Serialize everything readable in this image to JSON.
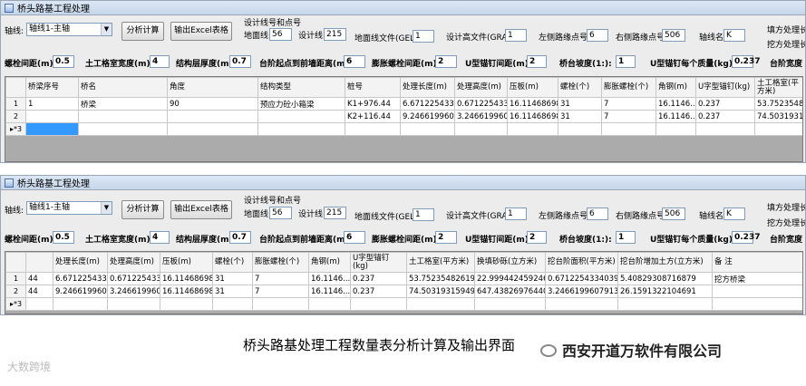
{
  "windows": [
    {
      "title": "桥头路基工程处理",
      "axis_label": "轴线:",
      "axis_value": "轴线1-主轴",
      "analyze_button": "分析计算",
      "export_button": "输出Excel表格",
      "design_line_label": "设计线号和点号",
      "ground_line_label": "地面线:",
      "ground_line_value": "56",
      "design_line_label2": "设计线:",
      "design_line_value": "215",
      "gel_label": "地面线文件(GEL):",
      "gel_value": "1",
      "gra_label": "设计高文件(GRA):",
      "gra_value": "1",
      "left_pt_label": "左侧路缘点号:",
      "left_pt_value": "6",
      "right_pt_label": "右侧路缘点号:",
      "right_pt_value": "506",
      "axis_name_label": "轴线名:",
      "axis_name_value": "K",
      "right_note1": "填方处理长度",
      "right_note2": "挖方处理长度",
      "params": [
        {
          "label": "螺栓间距(m):",
          "value": "0.5"
        },
        {
          "label": "土工格室宽度(m):",
          "value": "4"
        },
        {
          "label": "结构层厚度(m):",
          "value": "0.7"
        },
        {
          "label": "台阶起点到前墙距离(m):",
          "value": "6"
        },
        {
          "label": "膨胀螺栓间距(m):",
          "value": "2"
        },
        {
          "label": "U型锚钉间距(m):",
          "value": "2"
        },
        {
          "label": "桥台坡度(1:):",
          "value": "1"
        },
        {
          "label": "U型锚钉每个质量(kg):",
          "value": "0.237"
        },
        {
          "label": "台阶宽度",
          "value": ""
        }
      ],
      "table": {
        "headers": [
          "桥梁序号",
          "桥名",
          "角度",
          "结构类型",
          "桩号",
          "处理长度(m)",
          "处理高度(m)",
          "压板(m)",
          "螺栓(个)",
          "膨胀螺栓(个)",
          "角钢(m)",
          "U字型锚钉(kg)",
          "土工格室(平方米)"
        ],
        "rows": [
          {
            "n": "1",
            "cells": [
              "1",
              "桥梁",
              "90",
              "预应力砼小箱梁",
              "K1+976.44",
              "6.671225433...",
              "0.671225433...",
              "16.11468698...",
              "31",
              "7",
              "16.1146...",
              "0.237",
              "53.752354826192"
            ]
          },
          {
            "n": "2",
            "cells": [
              "",
              "",
              "",
              "",
              "K2+116.44",
              "9.246619960...",
              "3.246619960...",
              "16.11468698...",
              "31",
              "7",
              "16.1146...",
              "0.237",
              "74.5031931594923"
            ]
          },
          {
            "n": "▸*3",
            "cells": [
              "",
              "",
              "",
              "",
              "",
              "",
              "",
              "",
              "",
              "",
              "",
              "",
              ""
            ]
          }
        ]
      }
    },
    {
      "title": "桥头路基工程处理",
      "axis_label": "轴线:",
      "axis_value": "轴线1-主轴",
      "analyze_button": "分析计算",
      "export_button": "输出Excel表格",
      "design_line_label": "设计线号和点号",
      "ground_line_label": "地面线:",
      "ground_line_value": "56",
      "design_line_label2": "设计线:",
      "design_line_value": "215",
      "gel_label": "地面线文件(GEL):",
      "gel_value": "1",
      "gra_label": "设计高文件(GRA):",
      "gra_value": "1",
      "left_pt_label": "左侧路缘点号:",
      "left_pt_value": "6",
      "right_pt_label": "右侧路缘点号:",
      "right_pt_value": "506",
      "axis_name_label": "轴线名:",
      "axis_name_value": "K",
      "right_note1": "填方处理长度",
      "right_note2": "挖方处理长度",
      "params": [
        {
          "label": "螺栓间距(m):",
          "value": "0.5"
        },
        {
          "label": "土工格室宽度(m):",
          "value": "4"
        },
        {
          "label": "结构层厚度(m):",
          "value": "0.7"
        },
        {
          "label": "台阶起点到前墙距离(m):",
          "value": "6"
        },
        {
          "label": "膨胀螺栓间距(m):",
          "value": "2"
        },
        {
          "label": "U型锚钉间距(m):",
          "value": "2"
        },
        {
          "label": "桥台坡度(1:):",
          "value": "1"
        },
        {
          "label": "U型锚钉每个质量(kg):",
          "value": "0.237"
        },
        {
          "label": "台阶宽度",
          "value": ""
        }
      ],
      "table": {
        "headers": [
          "",
          "处理长度(m)",
          "处理高度(m)",
          "压板(m)",
          "螺栓(个)",
          "膨胀螺栓(个)",
          "角钢(m)",
          "U字型锚钉(kg)",
          "土工格室(平方米)",
          "换填砂砾(立方米)",
          "挖台阶面积(平方米)",
          "挖台阶增加土方(立方米)",
          "备 注"
        ],
        "rows": [
          {
            "n": "1",
            "cells": [
              "44",
              "6.671225433...",
              "0.671225433...",
              "16.11468698...",
              "31",
              "7",
              "16.1146...",
              "0.237",
              "53.752354826192",
              "22.999442459246",
              "0.671225433403902",
              "5.40829308716879",
              "挖方桥梁"
            ]
          },
          {
            "n": "2",
            "cells": [
              "44",
              "9.246619960...",
              "3.246619960...",
              "16.11468698...",
              "31",
              "7",
              "16.1146...",
              "0.237",
              "74.5031931594923",
              "647.438269764405",
              "3.24661996079139",
              "26.1591322104691",
              ""
            ]
          },
          {
            "n": "▸*3",
            "cells": [
              "",
              "",
              "",
              "",
              "",
              "",
              "",
              "",
              "",
              "",
              "",
              "",
              ""
            ]
          }
        ]
      }
    }
  ],
  "caption": "桥头路基处理工程数量表分析计算及输出界面",
  "company": "西安开道万软件有限公司",
  "watermark": "大数跨境"
}
